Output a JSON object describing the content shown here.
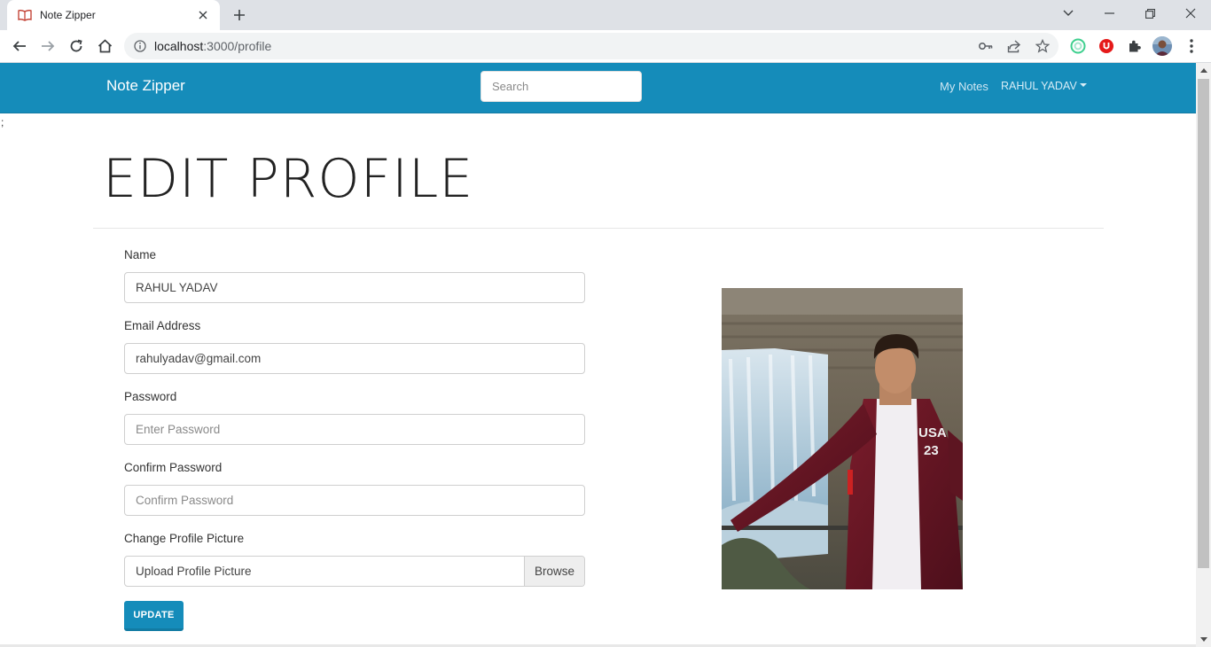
{
  "browser": {
    "tab_title": "Note Zipper",
    "url_host": "localhost",
    "url_path": ":3000/profile"
  },
  "navbar": {
    "brand": "Note Zipper",
    "search_placeholder": "Search",
    "my_notes": "My Notes",
    "user_menu": "RAHUL YADAV"
  },
  "page": {
    "stray_text": ";",
    "title": "EDIT PROFILE"
  },
  "form": {
    "name_label": "Name",
    "name_value": "RAHUL YADAV",
    "email_label": "Email Address",
    "email_value": "rahulyadav@gmail.com",
    "password_label": "Password",
    "password_placeholder": "Enter Password",
    "confirm_label": "Confirm Password",
    "confirm_placeholder": "Confirm Password",
    "picture_label": "Change Profile Picture",
    "picture_placeholder": "Upload Profile Picture",
    "browse_label": "Browse",
    "update_label": "UPDATE"
  },
  "colors": {
    "navbar": "#158cba",
    "accent": "#158cba"
  }
}
